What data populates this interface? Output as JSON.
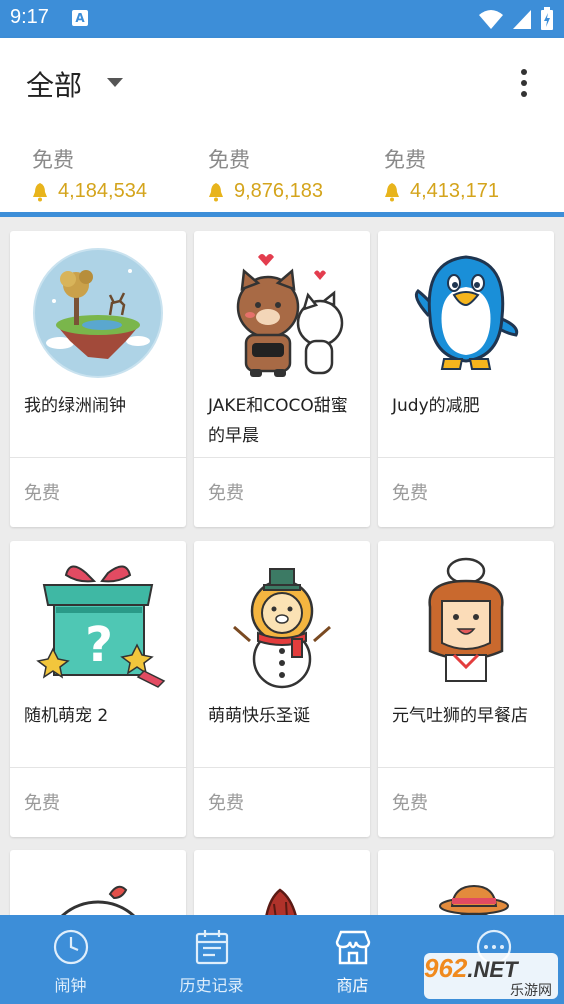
{
  "status_bar": {
    "time": "9:17",
    "notification_glyph": "A",
    "icons": [
      "wifi-icon",
      "signal-icon",
      "battery-charging-icon"
    ]
  },
  "header": {
    "filter": "全部"
  },
  "summary": [
    {
      "label": "免费",
      "count": "4,184,534"
    },
    {
      "label": "免费",
      "count": "9,876,183"
    },
    {
      "label": "免费",
      "count": "4,413,171"
    }
  ],
  "items": [
    {
      "title": "我的绿洲闹钟",
      "price": "免费",
      "icon": "floating-island-image"
    },
    {
      "title": "JAKE和COCO甜蜜的早晨",
      "price": "免费",
      "icon": "bear-and-cat-image"
    },
    {
      "title": "Judy的减肥",
      "price": "免费",
      "icon": "penguin-image"
    },
    {
      "title": "随机萌宠 2",
      "price": "免费",
      "icon": "mystery-gift-box-image"
    },
    {
      "title": "萌萌快乐圣诞",
      "price": "免费",
      "icon": "lion-snowman-image"
    },
    {
      "title": "元气吐狮的早餐店",
      "price": "免费",
      "icon": "lion-chef-image"
    },
    {
      "title": "",
      "price": "",
      "icon": "chick-image"
    },
    {
      "title": "",
      "price": "",
      "icon": "redhead-girl-image"
    },
    {
      "title": "",
      "price": "",
      "icon": "pink-pig-hat-image"
    }
  ],
  "nav": [
    {
      "label": "闹钟",
      "icon": "clock-icon"
    },
    {
      "label": "历史记录",
      "icon": "calendar-icon"
    },
    {
      "label": "商店",
      "icon": "store-icon",
      "active": true
    },
    {
      "label": "",
      "icon": "more-icon"
    }
  ],
  "watermark": {
    "brand": "962",
    "domain": ".NET",
    "subtitle": "乐游网"
  },
  "colors": {
    "primary": "#3d8ed8",
    "gold": "#d4a41c",
    "muted": "#9a9a9a"
  }
}
